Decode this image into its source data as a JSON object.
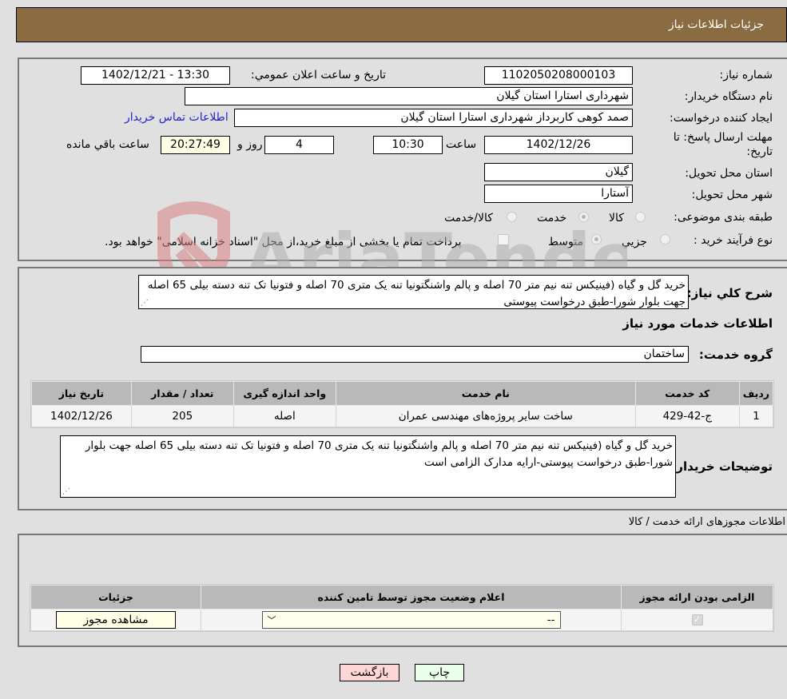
{
  "header": {
    "title": "جزئیات اطلاعات نیاز"
  },
  "form": {
    "need_number": {
      "label": "شماره نیاز:",
      "value": "1102050208000103"
    },
    "announce_datetime": {
      "label": "تاریخ و ساعت اعلان عمومي:",
      "value": "1402/12/21 - 13:30"
    },
    "buyer_org": {
      "label": "نام دستگاه خريدار:",
      "value": "شهرداری استارا استان گیلان"
    },
    "requester": {
      "label": "ایجاد کننده درخواست:",
      "value": "صمد کوهی کاربرداز شهرداری استارا استان گیلان"
    },
    "buyer_contact_link": "اطلاعات تماس خریدار",
    "deadline": {
      "label": "مهلت ارسال پاسخ: تا تاریخ:",
      "date": "1402/12/26",
      "time_label": "ساعت",
      "time": "10:30",
      "days": "4",
      "days_label": "روز و",
      "remaining": "20:27:49",
      "remaining_label": "ساعت باقي مانده"
    },
    "province": {
      "label": "استان محل تحویل:",
      "value": "گیلان"
    },
    "city": {
      "label": "شهر محل تحویل:",
      "value": "آستارا"
    },
    "category": {
      "label": "طبقه بندی موضوعی:",
      "options": [
        "کالا",
        "خدمت",
        "کالا/خدمت"
      ],
      "selected": "خدمت"
    },
    "purchase_process": {
      "label": "نوع فرآیند خرید :",
      "options": [
        "جزيي",
        "متوسط"
      ],
      "selected": "متوسط",
      "treasury_note": "پرداخت تمام یا بخشی از مبلغ خرید،از محل \"اسناد خزانه اسلامی\" خواهد بود."
    }
  },
  "description": {
    "label": "شرح کلي نیاز:",
    "value": "خرید گل و گیاه (فینیکس تنه نیم متر 70 اصله و پالم واشنگتونیا تنه یک متری 70 اصله و فتونیا تک تنه دسته بیلی 65 اصله جهت بلوار شورا-طبق درخواست پیوستی"
  },
  "services": {
    "section_title": "اطلاعات خدمات مورد نیاز",
    "group_label": "گروه خدمت:",
    "group_value": "ساختمان",
    "columns": [
      "ردیف",
      "کد خدمت",
      "نام خدمت",
      "واحد اندازه گیری",
      "تعداد / مقدار",
      "تاریخ نیاز"
    ],
    "rows": [
      [
        "1",
        "ج-42-429",
        "ساخت سایر پروژه‌های مهندسی عمران",
        "اصله",
        "205",
        "1402/12/26"
      ]
    ]
  },
  "buyer_notes": {
    "label": "توضیحات خریدار:",
    "value": "خرید گل و گیاه (فینیکس تنه نیم متر 70 اصله و پالم واشنگتونیا تنه یک متری 70 اصله و فتونیا تک تنه دسته بیلی 65 اصله جهت بلوار شورا-طبق درخواست پیوستی-ارایه مدارک الزامی است"
  },
  "permits": {
    "section_title": "اطلاعات مجوزهای ارائه خدمت / کالا",
    "columns": [
      "الزامی بودن ارائه مجوز",
      "اعلام وضعیت مجوز توسط تامین کننده",
      "جزئیات"
    ],
    "row": {
      "required": true,
      "status_value": "--",
      "details_button": "مشاهده مجوز"
    }
  },
  "buttons": {
    "print": "چاپ",
    "back": "بازگشت"
  },
  "watermark": {
    "text": "AriaTender.net"
  },
  "colors": {
    "header_bg": "#8b6c42",
    "link": "#2323c8",
    "back_btn": "#ffd6d6",
    "print_btn": "#eaffea"
  }
}
